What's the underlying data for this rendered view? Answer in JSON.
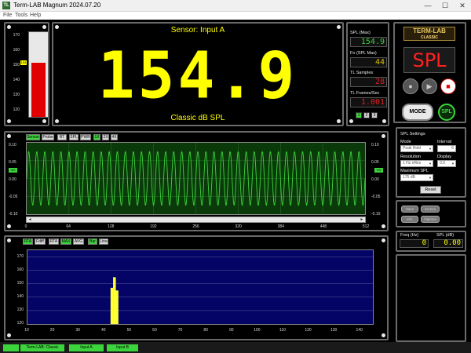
{
  "window": {
    "title": "Term-LAB Magnum 2024.07.20",
    "icon_label": "TL",
    "minimize": "—",
    "maximize": "☐",
    "close": "✕"
  },
  "menu": [
    "File",
    "Tools",
    "Help"
  ],
  "gauge": {
    "ticks": [
      "170",
      "160",
      "150",
      "140",
      "130",
      "120"
    ],
    "marker": "154",
    "min": 120,
    "max": 175,
    "level": 154.9
  },
  "main_display": {
    "sensor": "Sensor: Input A",
    "value": "154.9",
    "mode": "Classic dB SPL"
  },
  "readings": {
    "spl_max_label": "SPL (Max)",
    "spl_max_value": "154.9",
    "fo_label": "Fo (SPL Max)",
    "fo_value": "44",
    "samples_label": "TL Samples",
    "samples_value": "28",
    "fps_label": "TL Frames/Sec",
    "fps_value": "1.001",
    "pages": [
      "1",
      "2",
      "3"
    ]
  },
  "brand": {
    "logo": "TERM-LAB",
    "logo_sub": "CLASSIC",
    "spl_display": "SPL",
    "transport": {
      "record": "●",
      "play": "▶",
      "stop": "■"
    }
  },
  "mode_button": "MODE",
  "spl_badge": "SPL",
  "settings": {
    "title": "SPL Settings",
    "mode_label": "Mode",
    "mode_value": "Peak Hold",
    "interval_label": "Interval",
    "interval_value": "6",
    "resolution_label": "Resolution",
    "resolution_value": "1 Hz nRes",
    "display_label": "Display",
    "display_value": "0.0",
    "max_spl_label": "Maximum SPL",
    "max_spl_value": "175 dB",
    "reset": "Reset"
  },
  "side_buttons": [
    "Save",
    "Screen",
    "Info",
    "Options"
  ],
  "freq": {
    "freq_label": "Freq (Hz)",
    "freq_value": "0",
    "spl_label": "SPL (dB)",
    "spl_value": "0.00"
  },
  "waveform": {
    "tabs": [
      "Sensor",
      "Probe",
      "RT",
      "SPL",
      "PWR",
      "1X",
      "2X",
      "4X"
    ],
    "yticks": [
      "0.10",
      "0.05",
      "0.00",
      "-0.05",
      "-0.10"
    ],
    "xticks": [
      "0",
      "64",
      "128",
      "192",
      "256",
      "320",
      "384",
      "448",
      "512"
    ],
    "channel_left": "V/0",
    "channel_right": "V/0",
    "scroll_left": "◄",
    "scroll_right": "►",
    "cycles": 42,
    "amplitude": 0.075
  },
  "spectrum": {
    "tabs": [
      "RTA",
      "Fdiff",
      "RTA",
      "MAX",
      "AVG",
      "Bar",
      "Line"
    ],
    "yticks": [
      "170",
      "160",
      "150",
      "140",
      "130",
      "120"
    ],
    "xticks": [
      "10",
      "20",
      "30",
      "40",
      "50",
      "60",
      "70",
      "80",
      "90",
      "100",
      "110",
      "120",
      "130",
      "140"
    ]
  },
  "chart_data": {
    "type": "bar",
    "x": [
      43,
      44,
      45
    ],
    "values": [
      147,
      154.9,
      145
    ],
    "xlim": [
      10,
      145
    ],
    "ylim": [
      120,
      175
    ],
    "color": "#ffff33"
  },
  "status": [
    "",
    "Term-LAB: Classic",
    "Input A",
    "Input B"
  ],
  "colors": {
    "accent_green": "#3cd43c",
    "display_yellow": "#ffff00",
    "alarm_red": "#e00000"
  }
}
